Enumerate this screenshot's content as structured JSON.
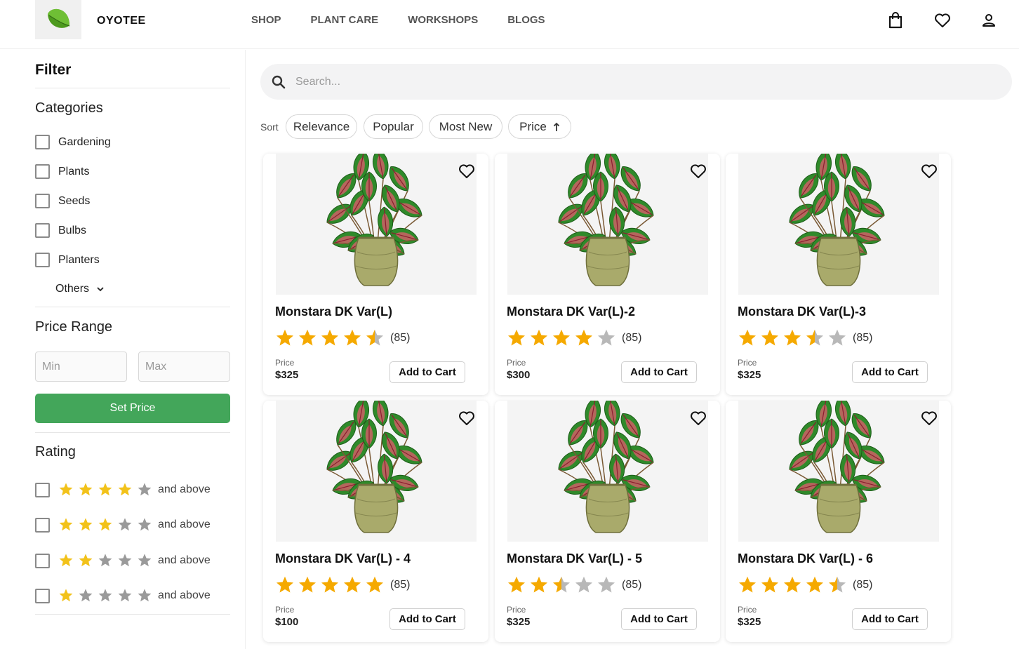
{
  "header": {
    "brand": "OYOTEE",
    "nav": [
      "SHOP",
      "PLANT CARE",
      "WORKSHOPS",
      "BLOGS"
    ],
    "icons": [
      "shopping-bag-icon",
      "heart-icon",
      "user-icon"
    ]
  },
  "sidebar": {
    "filter_title": "Filter",
    "categories_title": "Categories",
    "categories": [
      "Gardening",
      "Plants",
      "Seeds",
      "Bulbs",
      "Planters"
    ],
    "others_label": "Others",
    "price_range_title": "Price Range",
    "min_placeholder": "Min",
    "max_placeholder": "Max",
    "set_price_label": "Set Price",
    "rating_title": "Rating",
    "rating_filters": [
      {
        "stars": 4,
        "label": "and above"
      },
      {
        "stars": 3,
        "label": "and above"
      },
      {
        "stars": 2,
        "label": "and above"
      },
      {
        "stars": 1,
        "label": "and above"
      }
    ]
  },
  "search": {
    "placeholder": "Search..."
  },
  "sort": {
    "label": "Sort",
    "options": [
      "Relevance",
      "Popular",
      "Most New",
      "Price"
    ],
    "price_direction_icon": "arrow-up-icon"
  },
  "products": [
    {
      "name": "Monstara DK Var(L)",
      "rating": 4.5,
      "reviews": "(85)",
      "price_label": "Price",
      "price": "$325",
      "cta": "Add to Cart"
    },
    {
      "name": "Monstara DK Var(L)-2",
      "rating": 4,
      "reviews": "(85)",
      "price_label": "Price",
      "price": "$300",
      "cta": "Add to Cart"
    },
    {
      "name": "Monstara DK Var(L)-3",
      "rating": 3.5,
      "reviews": "(85)",
      "price_label": "Price",
      "price": "$325",
      "cta": "Add to Cart"
    },
    {
      "name": "Monstara DK Var(L) - 4",
      "rating": 5,
      "reviews": "(85)",
      "price_label": "Price",
      "price": "$100",
      "cta": "Add to Cart"
    },
    {
      "name": "Monstara DK Var(L) - 5",
      "rating": 2.5,
      "reviews": "(85)",
      "price_label": "Price",
      "price": "$325",
      "cta": "Add to Cart"
    },
    {
      "name": "Monstara DK Var(L) - 6",
      "rating": 4.5,
      "reviews": "(85)",
      "price_label": "Price",
      "price": "$325",
      "cta": "Add to Cart"
    }
  ],
  "colors": {
    "accent_green": "#43a65a",
    "star_filled": "#f5a900",
    "star_empty": "#b8b8b8",
    "sidebar_star": "#f2c21a"
  }
}
